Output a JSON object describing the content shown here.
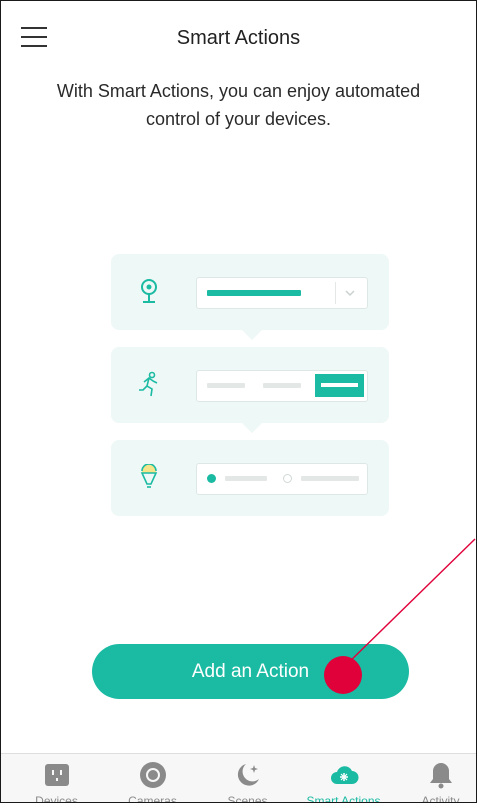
{
  "header": {
    "title": "Smart Actions"
  },
  "intro": {
    "text": "With Smart Actions, you can enjoy automated control of your devices."
  },
  "add_button": {
    "label": "Add an Action"
  },
  "tabs": [
    {
      "label": "Devices",
      "icon": "plug-icon",
      "active": false
    },
    {
      "label": "Cameras",
      "icon": "camera-icon",
      "active": false
    },
    {
      "label": "Scenes",
      "icon": "moon-stars-icon",
      "active": false
    },
    {
      "label": "Smart Actions",
      "icon": "cloud-sparkle-icon",
      "active": true
    },
    {
      "label": "Activity",
      "icon": "bell-icon",
      "active": false
    }
  ],
  "colors": {
    "accent": "#1bbba3",
    "annotation": "#e0003a",
    "card_bg": "#eef8f6"
  }
}
